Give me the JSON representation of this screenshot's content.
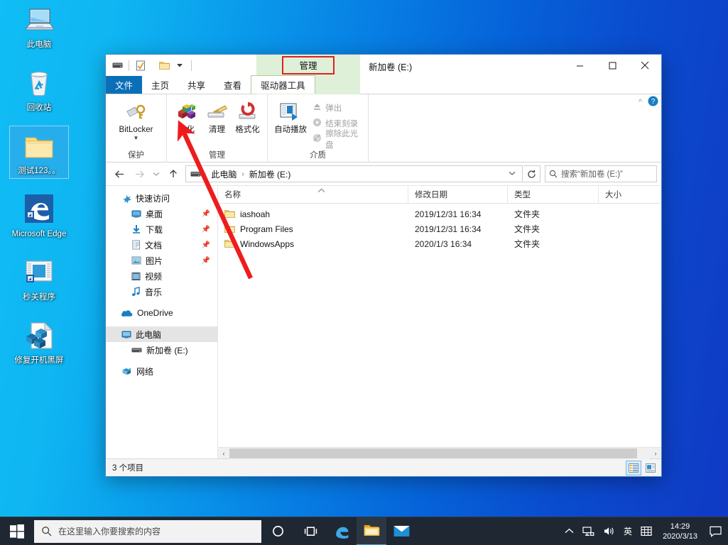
{
  "desktop": {
    "icons": [
      {
        "name": "此电脑",
        "icon": "computer-icon",
        "selected": false
      },
      {
        "name": "回收站",
        "icon": "recycle-bin-icon",
        "selected": false
      },
      {
        "name": "测试123。。",
        "icon": "folder-icon",
        "selected": true
      },
      {
        "name": "Microsoft Edge",
        "icon": "edge-icon",
        "selected": false
      },
      {
        "name": "秒关程序",
        "icon": "window-shortcut-icon",
        "selected": false
      },
      {
        "name": "修复开机黑屏",
        "icon": "script-file-icon",
        "selected": false
      }
    ]
  },
  "explorer": {
    "title": "新加卷 (E:)",
    "quick_access_toolbar": [
      {
        "name": "drive-properties-icon"
      },
      {
        "name": "properties-checkmark-icon"
      },
      {
        "name": "new-folder-icon"
      },
      {
        "name": "customize-qat-chevron-icon"
      }
    ],
    "window_controls": {
      "minimize": "—",
      "maximize": "☐",
      "close": "✕"
    },
    "contextual_tab_group": "管理",
    "ribbon_collapse": "^",
    "help": "?",
    "tabs": [
      {
        "label": "文件",
        "type": "file"
      },
      {
        "label": "主页",
        "type": "normal"
      },
      {
        "label": "共享",
        "type": "normal"
      },
      {
        "label": "查看",
        "type": "normal"
      },
      {
        "label": "驱动器工具",
        "type": "contextual",
        "active": true
      }
    ],
    "ribbon_groups": [
      {
        "title": "保护",
        "big_buttons": [
          {
            "label": "BitLocker",
            "icon": "bitlocker-key-icon",
            "has_caret": true,
            "enabled": true
          }
        ],
        "small_buttons": []
      },
      {
        "title": "管理",
        "big_buttons": [
          {
            "label": "优化",
            "icon": "optimize-drive-icon",
            "has_caret": false,
            "enabled": true
          },
          {
            "label": "清理",
            "icon": "cleanup-broom-icon",
            "has_caret": false,
            "enabled": true
          },
          {
            "label": "格式化",
            "icon": "format-drive-icon",
            "has_caret": false,
            "enabled": true
          }
        ],
        "small_buttons": []
      },
      {
        "title": "介质",
        "big_buttons": [
          {
            "label": "自动播放",
            "icon": "autoplay-icon",
            "has_caret": false,
            "enabled": true
          }
        ],
        "small_buttons": [
          {
            "label": "弹出",
            "icon": "eject-icon",
            "enabled": false
          },
          {
            "label": "结束刻录",
            "icon": "finish-burning-icon",
            "enabled": false
          },
          {
            "label": "擦除此光盘",
            "icon": "erase-disc-icon",
            "enabled": false
          }
        ]
      }
    ],
    "navigation": {
      "back": "←",
      "forward": "→",
      "recent": "⌄",
      "up": "↑"
    },
    "breadcrumb": {
      "drive_icon": "drive-icon",
      "items": [
        "此电脑",
        "新加卷 (E:)"
      ],
      "separator": "›",
      "dropdown": "⌄"
    },
    "refresh": "↻",
    "search": {
      "icon": "search-icon",
      "placeholder": "搜索“新加卷 (E:)”"
    },
    "nav_pane": [
      {
        "label": "快速访问",
        "icon": "quick-access-star-icon",
        "indent": false,
        "pinned": false,
        "selected": false
      },
      {
        "label": "桌面",
        "icon": "desktop-icon",
        "indent": true,
        "pinned": true,
        "selected": false
      },
      {
        "label": "下载",
        "icon": "downloads-icon",
        "indent": true,
        "pinned": true,
        "selected": false
      },
      {
        "label": "文档",
        "icon": "documents-icon",
        "indent": true,
        "pinned": true,
        "selected": false
      },
      {
        "label": "图片",
        "icon": "pictures-icon",
        "indent": true,
        "pinned": true,
        "selected": false
      },
      {
        "label": "视频",
        "icon": "videos-icon",
        "indent": true,
        "pinned": false,
        "selected": false
      },
      {
        "label": "音乐",
        "icon": "music-icon",
        "indent": true,
        "pinned": false,
        "selected": false
      },
      {
        "label": "OneDrive",
        "icon": "onedrive-cloud-icon",
        "indent": false,
        "pinned": false,
        "selected": false
      },
      {
        "label": "此电脑",
        "icon": "computer-icon",
        "indent": false,
        "pinned": false,
        "selected": true
      },
      {
        "label": "新加卷 (E:)",
        "icon": "drive-icon",
        "indent": true,
        "pinned": false,
        "selected": false
      },
      {
        "label": "网络",
        "icon": "network-icon",
        "indent": false,
        "pinned": false,
        "selected": false
      }
    ],
    "columns": [
      "名称",
      "修改日期",
      "类型",
      "大小"
    ],
    "sort_indicator": "^",
    "rows": [
      {
        "name": "iashoah",
        "date": "2019/12/31 16:34",
        "type": "文件夹",
        "size": ""
      },
      {
        "name": "Program Files",
        "date": "2019/12/31 16:34",
        "type": "文件夹",
        "size": ""
      },
      {
        "name": "WindowsApps",
        "date": "2020/1/3 16:34",
        "type": "文件夹",
        "size": ""
      }
    ],
    "scrollbar": {
      "left_arrow": "‹",
      "right_arrow": "›"
    },
    "status": "3 个项目",
    "view_buttons": [
      {
        "name": "details-view-icon",
        "active": true
      },
      {
        "name": "large-icons-view-icon",
        "active": false
      }
    ]
  },
  "taskbar": {
    "start": "start-icon",
    "search_placeholder": "在这里输入你要搜索的内容",
    "search_icon": "search-icon",
    "buttons": [
      {
        "name": "cortana-icon"
      },
      {
        "name": "task-view-icon"
      },
      {
        "name": "edge-icon"
      },
      {
        "name": "file-explorer-icon",
        "active": true
      },
      {
        "name": "mail-icon"
      }
    ],
    "tray": [
      {
        "name": "show-hidden-icons-chevron",
        "glyph": "⌃"
      },
      {
        "name": "network-icon",
        "glyph": "network"
      },
      {
        "name": "volume-icon",
        "glyph": "volume"
      },
      {
        "name": "input-method-icon",
        "glyph": "英"
      },
      {
        "name": "ime-keyboard-icon",
        "glyph": "keyboard"
      }
    ],
    "clock": {
      "time": "14:29",
      "date": "2020/3/13"
    },
    "action_center": "action-center-icon"
  },
  "annotation": {
    "arrow_color": "#ee1c1c",
    "highlight_box_color": "#e02020",
    "highlight_bg_color": "#dff0d8"
  }
}
